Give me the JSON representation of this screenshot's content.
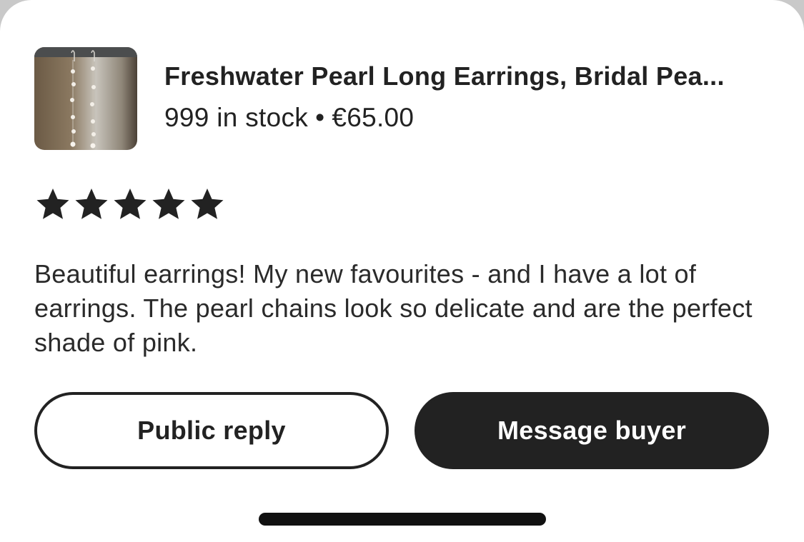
{
  "listing": {
    "thumbnail_alt": "pearl-earrings-photo",
    "title": "Freshwater Pearl Long Earrings, Bridal Pea...",
    "stock": "999 in stock",
    "separator": "•",
    "price": "€65.00"
  },
  "review": {
    "rating": 5,
    "rating_max": 5,
    "star_icon": "star-icon",
    "text": "Beautiful earrings! My new favourites - and I have a lot of earrings. The pearl chains look so delicate and are the perfect shade of pink."
  },
  "actions": {
    "public_reply_label": "Public reply",
    "message_buyer_label": "Message buyer"
  },
  "colors": {
    "text": "#222222",
    "button_dark": "#222222",
    "background": "#ffffff"
  }
}
